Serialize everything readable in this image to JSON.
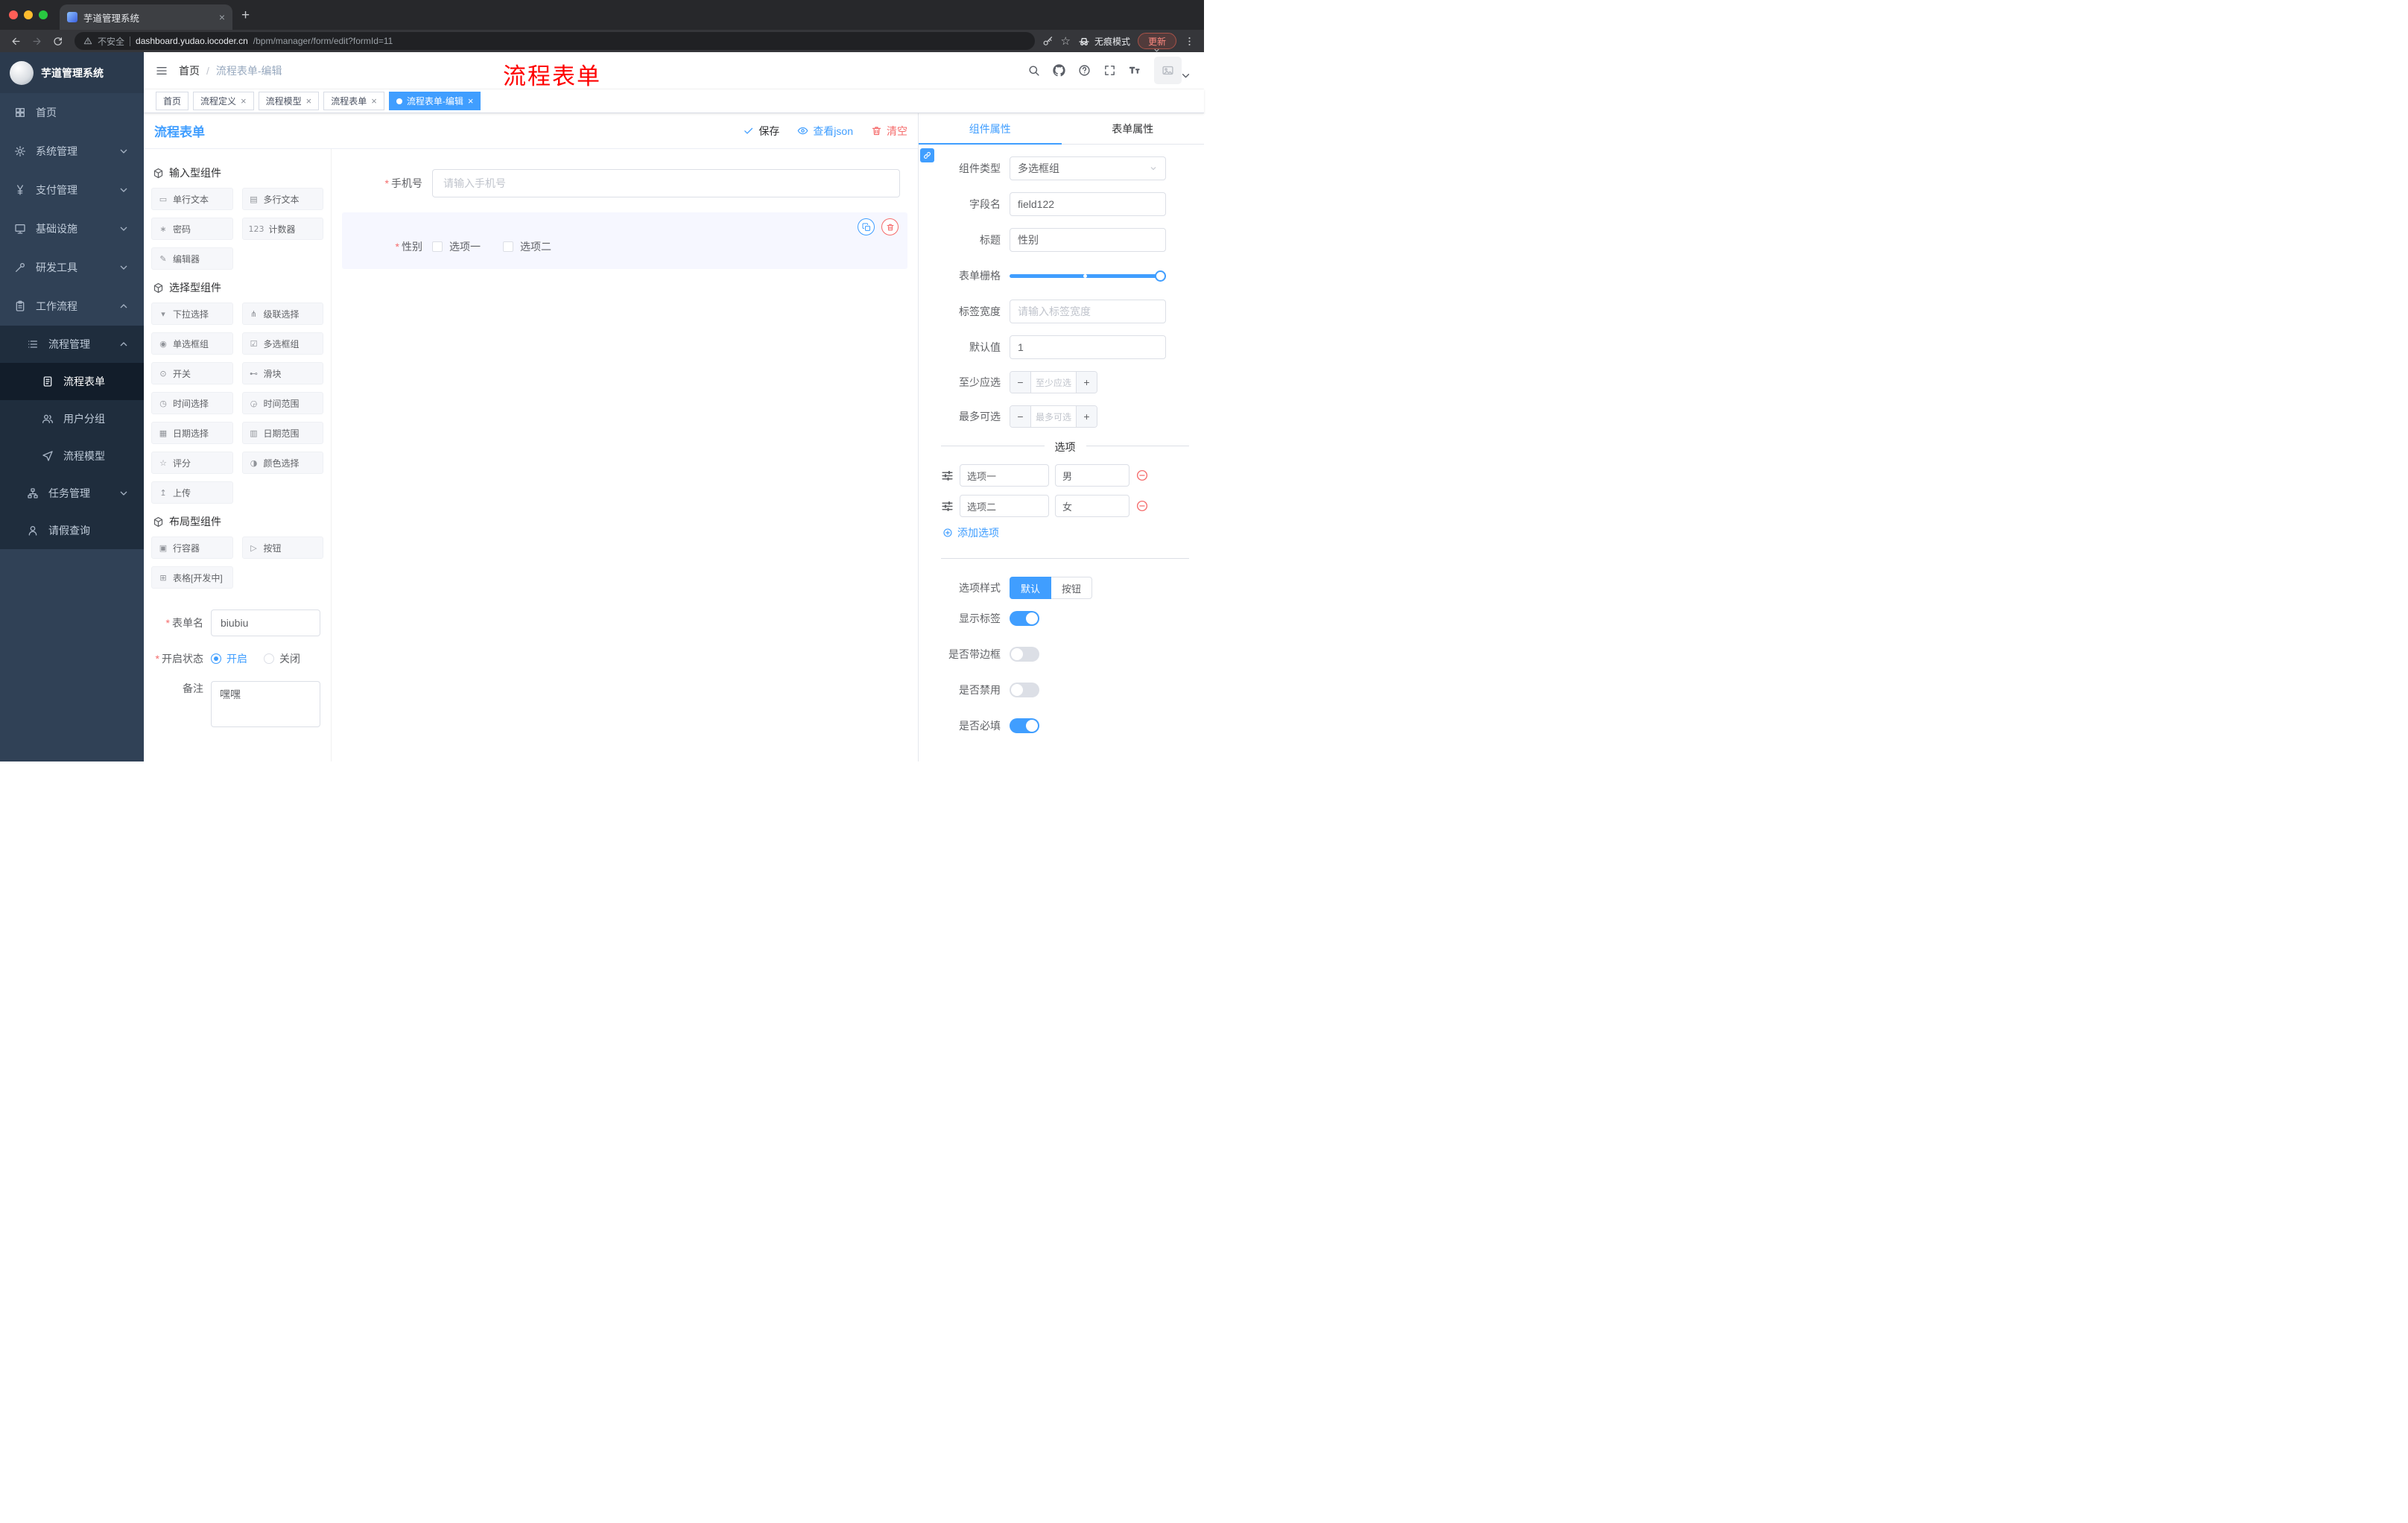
{
  "glyphs": {
    "close": "×",
    "new_tab": "+",
    "minus": "−",
    "plus": "+",
    "star": "☆"
  },
  "browser": {
    "tab_title": "芋道管理系统",
    "security_label": "不安全",
    "url_host": "dashboard.yudao.iocoder.cn",
    "url_path": "/bpm/manager/form/edit?formId=11",
    "incognito_label": "无痕模式",
    "update_label": "更新"
  },
  "sidebar": {
    "logo_title": "芋道管理系统",
    "menu": [
      {
        "label": "首页"
      },
      {
        "label": "系统管理"
      },
      {
        "label": "支付管理"
      },
      {
        "label": "基础设施"
      },
      {
        "label": "研发工具"
      },
      {
        "label": "工作流程"
      }
    ],
    "submenu_label": "流程管理",
    "submenu_items": [
      {
        "label": "流程表单",
        "active": true
      },
      {
        "label": "用户分组",
        "active": false
      },
      {
        "label": "流程模型",
        "active": false
      }
    ],
    "task_label": "任务管理",
    "leave_label": "请假查询"
  },
  "header": {
    "breadcrumb_home": "首页",
    "breadcrumb_separator": "/",
    "breadcrumb_current": "流程表单-编辑",
    "annotation": "流程表单"
  },
  "tags": [
    {
      "label": "首页",
      "closable": false,
      "active": false
    },
    {
      "label": "流程定义",
      "closable": true,
      "active": false
    },
    {
      "label": "流程模型",
      "closable": true,
      "active": false
    },
    {
      "label": "流程表单",
      "closable": true,
      "active": false
    },
    {
      "label": "流程表单-编辑",
      "closable": true,
      "active": true
    }
  ],
  "editor": {
    "title": "流程表单",
    "save_label": "保存",
    "view_json_label": "查看json",
    "clear_label": "清空"
  },
  "palette": {
    "input_section": "输入型组件",
    "input_components": [
      {
        "icon": "single-line-text-icon",
        "glyph": "▭",
        "label": "单行文本"
      },
      {
        "icon": "multi-line-text-icon",
        "glyph": "▤",
        "label": "多行文本"
      },
      {
        "icon": "password-icon",
        "glyph": "∗",
        "label": "密码"
      },
      {
        "icon": "counter-icon",
        "glyph": "123",
        "label": "计数器"
      },
      {
        "icon": "rich-editor-icon",
        "glyph": "✎",
        "label": "编辑器"
      }
    ],
    "select_section": "选择型组件",
    "select_components": [
      {
        "icon": "dropdown-select-icon",
        "glyph": "▾",
        "label": "下拉选择"
      },
      {
        "icon": "cascader-icon",
        "glyph": "⋔",
        "label": "级联选择"
      },
      {
        "icon": "radio-group-icon",
        "glyph": "◉",
        "label": "单选框组"
      },
      {
        "icon": "checkbox-group-icon",
        "glyph": "☑",
        "label": "多选框组"
      },
      {
        "icon": "switch-icon",
        "glyph": "⊙",
        "label": "开关"
      },
      {
        "icon": "slider-icon",
        "glyph": "⊷",
        "label": "滑块"
      },
      {
        "icon": "time-picker-icon",
        "glyph": "◷",
        "label": "时间选择"
      },
      {
        "icon": "time-range-icon",
        "glyph": "◶",
        "label": "时间范围"
      },
      {
        "icon": "date-picker-icon",
        "glyph": "▦",
        "label": "日期选择"
      },
      {
        "icon": "date-range-icon",
        "glyph": "▥",
        "label": "日期范围"
      },
      {
        "icon": "rate-icon",
        "glyph": "☆",
        "label": "评分"
      },
      {
        "icon": "color-picker-icon",
        "glyph": "◑",
        "label": "颜色选择"
      },
      {
        "icon": "upload-icon",
        "glyph": "↥",
        "label": "上传"
      }
    ],
    "layout_section": "布局型组件",
    "layout_components": [
      {
        "icon": "row-container-icon",
        "glyph": "▣",
        "label": "行容器"
      },
      {
        "icon": "button-icon",
        "glyph": "▷",
        "label": "按钮"
      },
      {
        "icon": "table-icon",
        "glyph": "⊞",
        "label": "表格[开发中]"
      }
    ]
  },
  "form_settings": {
    "name_label": "表单名",
    "name_value": "biubiu",
    "status_label": "开启状态",
    "status_on": "开启",
    "status_off": "关闭",
    "status_value": "开启",
    "remark_label": "备注",
    "remark_value": "嘿嘿"
  },
  "canvas": {
    "phone": {
      "label": "手机号",
      "placeholder": "请输入手机号"
    },
    "gender": {
      "label": "性别",
      "options": [
        "选项一",
        "选项二"
      ]
    }
  },
  "properties": {
    "tab_component": "组件属性",
    "tab_form": "表单属性",
    "component_type_label": "组件类型",
    "component_type_value": "多选框组",
    "field_name_label": "字段名",
    "field_name_value": "field122",
    "title_label": "标题",
    "title_value": "性别",
    "grid_label": "表单栅格",
    "label_width_label": "标签宽度",
    "label_width_placeholder": "请输入标签宽度",
    "default_label": "默认值",
    "default_value": "1",
    "min_label": "至少应选",
    "min_placeholder": "至少应选",
    "max_label": "最多可选",
    "max_placeholder": "最多可选",
    "options_divider": "选项",
    "options": [
      {
        "label": "选项一",
        "value": "男"
      },
      {
        "label": "选项二",
        "value": "女"
      }
    ],
    "add_option_label": "添加选项",
    "option_style_label": "选项样式",
    "option_style_default": "默认",
    "option_style_button": "按钮",
    "toggles": [
      {
        "label": "显示标签",
        "on": true
      },
      {
        "label": "是否带边框",
        "on": false
      },
      {
        "label": "是否禁用",
        "on": false
      },
      {
        "label": "是否必填",
        "on": true
      }
    ]
  }
}
